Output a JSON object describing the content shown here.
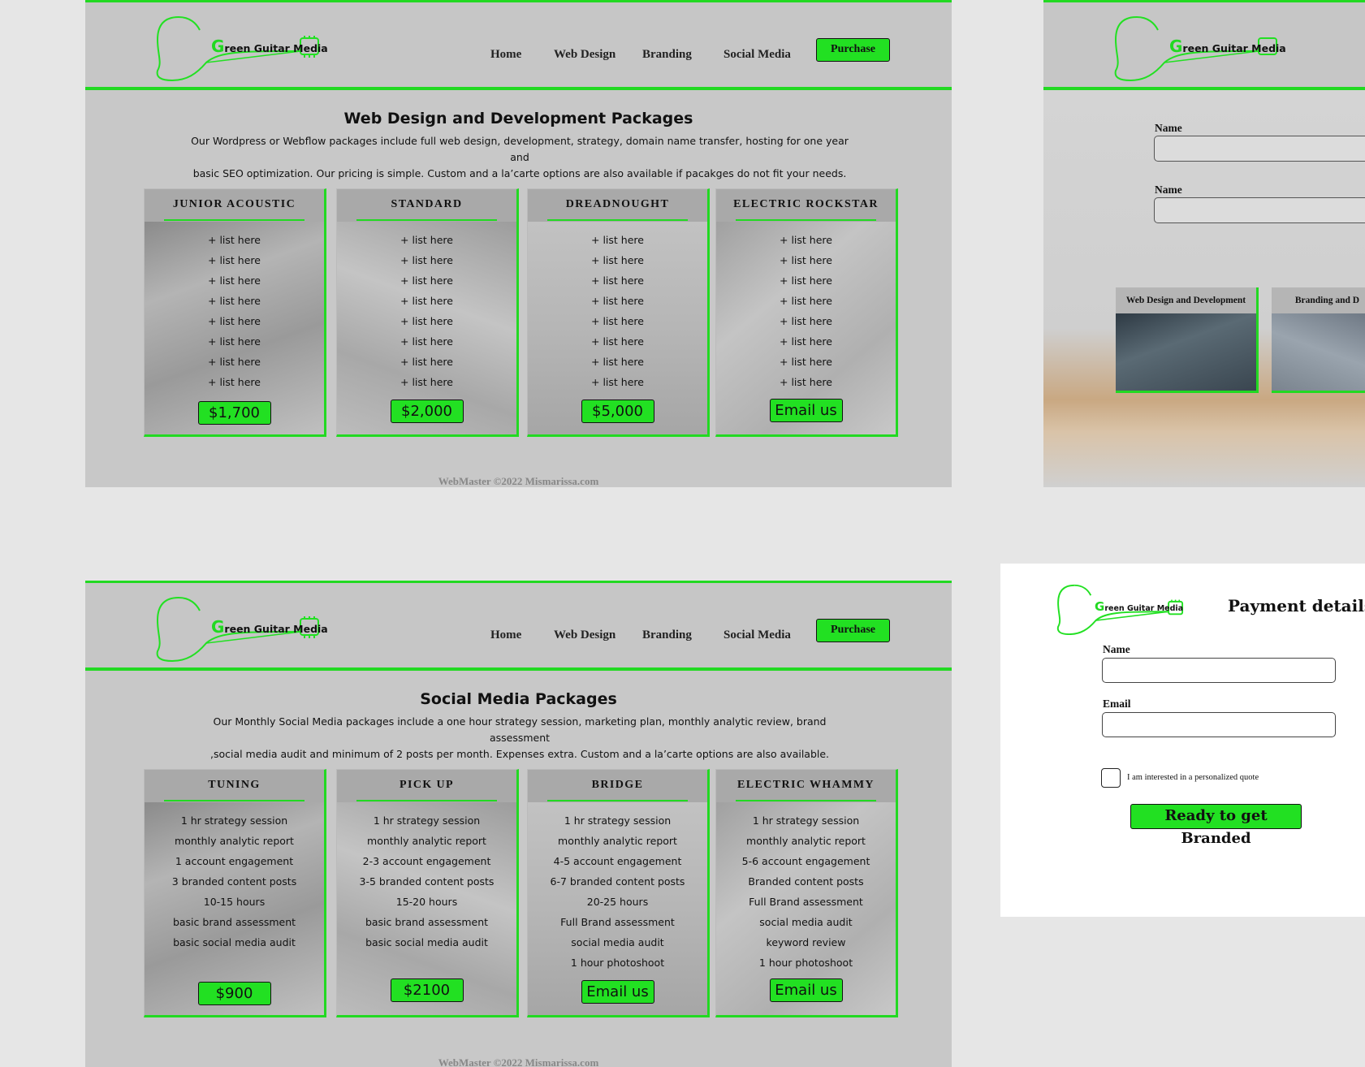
{
  "brand": {
    "logo_initial": "G",
    "logo_rest": "reen Guitar Media"
  },
  "nav": {
    "home": "Home",
    "web_design": "Web Design",
    "branding": "Branding",
    "social_media": "Social Media",
    "purchase": "Purchase"
  },
  "web_page": {
    "title": "Web Design and Development Packages",
    "desc_line1": "Our Wordpress or Webflow packages include full web design, development, strategy, domain name transfer, hosting for one year and",
    "desc_line2": "basic SEO optimization.  Our pricing is simple. Custom and a la’carte options are also available if pacakges do not fit your needs.",
    "cards": [
      {
        "title": "JUNIOR  ACOUSTIC",
        "items": [
          "+ list here",
          "+ list here",
          "+ list here",
          "+ list here",
          "+ list here",
          "+ list here",
          "+ list here",
          "+ list here"
        ],
        "price": "$1,700"
      },
      {
        "title": "STANDARD",
        "items": [
          "+ list here",
          "+ list here",
          "+ list here",
          "+ list here",
          "+ list here",
          "+ list here",
          "+ list here",
          "+ list here"
        ],
        "price": "$2,000"
      },
      {
        "title": "DREADNOUGHT",
        "items": [
          "+ list here",
          "+ list here",
          "+ list here",
          "+ list here",
          "+ list here",
          "+ list here",
          "+ list here",
          "+ list here"
        ],
        "price": "$5,000"
      },
      {
        "title": "ELECTRIC  ROCKSTAR",
        "items": [
          "+ list here",
          "+ list here",
          "+ list here",
          "+ list here",
          "+ list here",
          "+ list here",
          "+ list here",
          "+ list here"
        ],
        "price": "Email us"
      }
    ],
    "footer": "WebMaster  ©2022 Mismarissa.com"
  },
  "social_page": {
    "title": "Social Media Packages",
    "desc_line1": "Our Monthly Social Media packages include  a one hour strategy session, marketing plan, monthly analytic review, brand assessment",
    "desc_line2": ",social media audit and minimum of 2 posts per month.  Expenses extra. Custom and a la’carte options are also available.",
    "cards": [
      {
        "title": "TUNING",
        "items": [
          "1 hr strategy session",
          "monthly analytic report",
          "1 account engagement",
          "3 branded content posts",
          "10-15 hours",
          "basic brand assessment",
          "basic social media audit"
        ],
        "price": "$900"
      },
      {
        "title": "PICK UP",
        "items": [
          "1 hr strategy session",
          "monthly analytic report",
          "2-3 account engagement",
          "3-5 branded content posts",
          "15-20 hours",
          "basic brand assessment",
          "basic social media audit"
        ],
        "price": "$2100"
      },
      {
        "title": "BRIDGE",
        "items": [
          "1 hr strategy session",
          "monthly analytic report",
          "4-5 account engagement",
          "6-7 branded content posts",
          "20-25 hours",
          "Full Brand assessment",
          "social media audit",
          "1 hour photoshoot"
        ],
        "price": "Email us"
      },
      {
        "title": "ELECTRIC WHAMMY",
        "items": [
          "1 hr strategy session",
          "monthly analytic report",
          "5-6 account engagement",
          "Branded content posts",
          "Full Brand assessment",
          "social media audit",
          "keyword review",
          "1 hour photoshoot"
        ],
        "price": "Email us"
      }
    ],
    "footer": "WebMaster  ©2022 Mismarissa.com"
  },
  "contact_page": {
    "label1": "Name",
    "label2": "Name",
    "mini_card1": "Web Design and Development",
    "mini_card2": "Branding and D"
  },
  "payment": {
    "title": "Payment details",
    "name_label": "Name",
    "email_label": "Email",
    "checkbox_label": "I am interested in a personalized quote",
    "submit": "Ready to get Branded"
  }
}
